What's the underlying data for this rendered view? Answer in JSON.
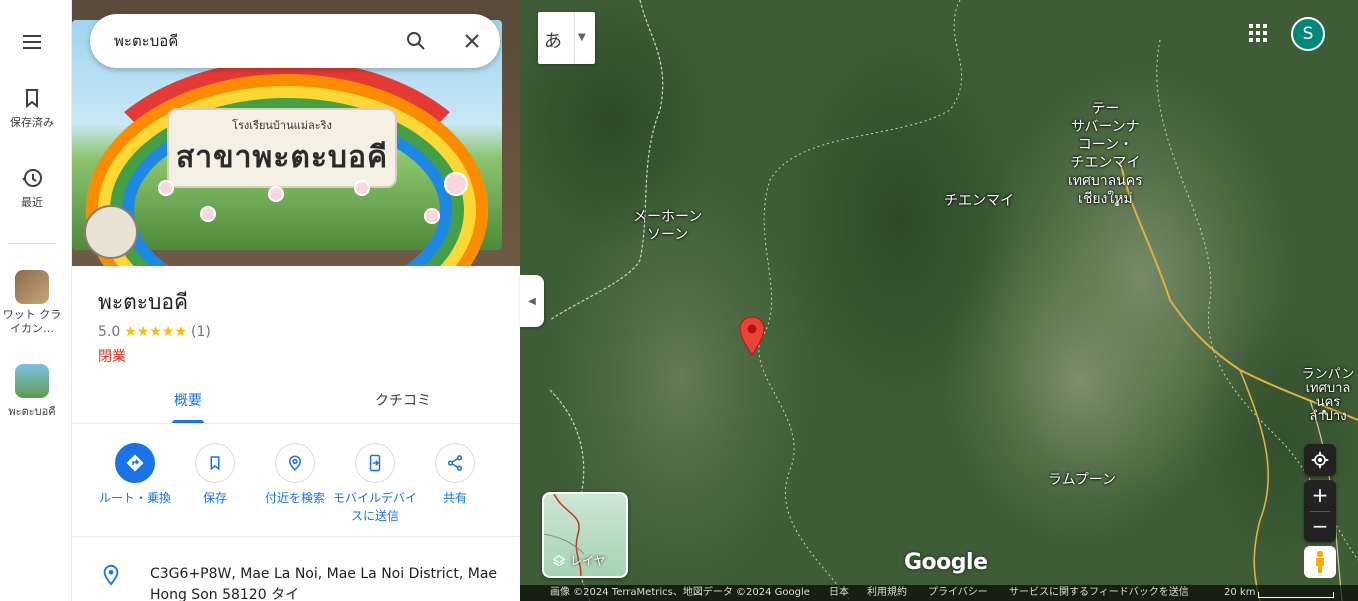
{
  "rail": {
    "menu_icon": "menu-icon",
    "saved_label": "保存済み",
    "recent_label": "最近",
    "recent_items": [
      {
        "label": "ワット クライカン…"
      },
      {
        "label": "พะตะบอคี"
      }
    ]
  },
  "search": {
    "value": "พะตะบอคี",
    "search_icon": "search-icon",
    "clear_icon": "close-icon"
  },
  "hero": {
    "sign_small": "โรงเรียนบ้านแม่ละริง",
    "sign_big": "สาขาพะตะบอคี"
  },
  "place": {
    "name": "พะตะบอคี",
    "rating": "5.0",
    "stars": "★★★★★",
    "review_count": "(1)",
    "status": "閉業",
    "tabs": [
      {
        "label": "概要"
      },
      {
        "label": "クチコミ"
      }
    ],
    "actions": [
      {
        "label": "ルート・乗換",
        "icon": "directions-icon"
      },
      {
        "label": "保存",
        "icon": "bookmark-icon"
      },
      {
        "label": "付近を検索",
        "icon": "nearby-icon"
      },
      {
        "label": "モバイルデバイスに送信",
        "icon": "send-to-phone-icon"
      },
      {
        "label": "共有",
        "icon": "share-icon"
      }
    ],
    "address": "C3G6+P8W, Mae La Noi, Mae La Noi District, Mae Hong Son 58120 タイ"
  },
  "map": {
    "lang_button": "あ",
    "avatar_initial": "S",
    "labels": [
      {
        "text": "メーホーン\nソーン"
      },
      {
        "text": "チエンマイ"
      },
      {
        "text": "テー\nサバーンナ\nコーン・\nチエンマイ\nเทศบาลนคร\nเชียงใหม่"
      },
      {
        "text": "ランパン\nเทศบาล\nนครลำปาง"
      },
      {
        "text": "ラムプーン"
      }
    ],
    "layer_label": "レイヤ",
    "google": "Google",
    "attribution": {
      "imagery": "画像 ©2024 TerraMetrics、地図データ ©2024 Google",
      "country": "日本",
      "terms": "利用規約",
      "privacy": "プライバシー",
      "feedback": "サービスに関するフィードバックを送信",
      "scale": "20 km"
    }
  }
}
